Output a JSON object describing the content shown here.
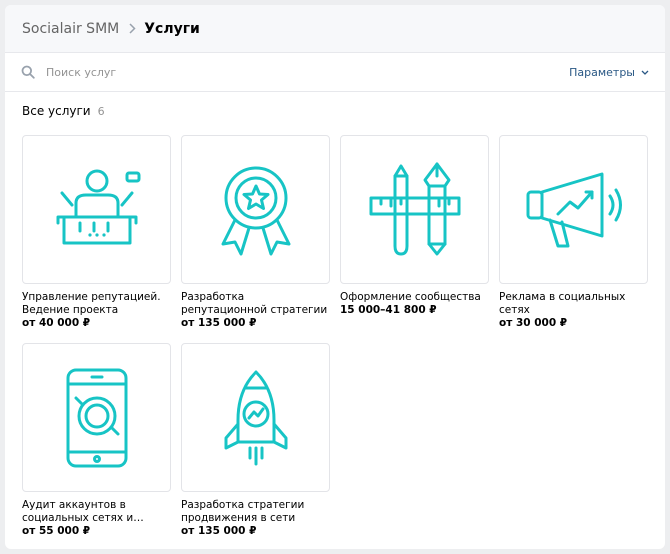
{
  "breadcrumb": {
    "root": "Socialair SMM",
    "current": "Услуги"
  },
  "search": {
    "placeholder": "Поиск услуг",
    "value": "",
    "params_label": "Параметры"
  },
  "section": {
    "title": "Все услуги",
    "count": "6"
  },
  "colors": {
    "accent": "#17c4c5",
    "link": "#2a5885"
  },
  "services": [
    {
      "icon": "speaker-podium-icon",
      "title": "Управление репутацией. Ведение проекта",
      "price": "от 40 000 ₽"
    },
    {
      "icon": "award-ribbon-icon",
      "title": "Разработка репутационной стратегии",
      "price": "от 135 000 ₽"
    },
    {
      "icon": "design-tools-icon",
      "title": "Оформление сообщества",
      "price": "15 000–41 800 ₽"
    },
    {
      "icon": "megaphone-icon",
      "title": "Реклама в социальных сетях",
      "price": "от 30 000 ₽"
    },
    {
      "icon": "smartphone-camera-icon",
      "title": "Аудит аккаунтов в социальных сетях и…",
      "price": "от 55 000 ₽"
    },
    {
      "icon": "rocket-icon",
      "title": "Разработка стратегии продвижения в сети",
      "price": "от 135 000 ₽"
    }
  ]
}
